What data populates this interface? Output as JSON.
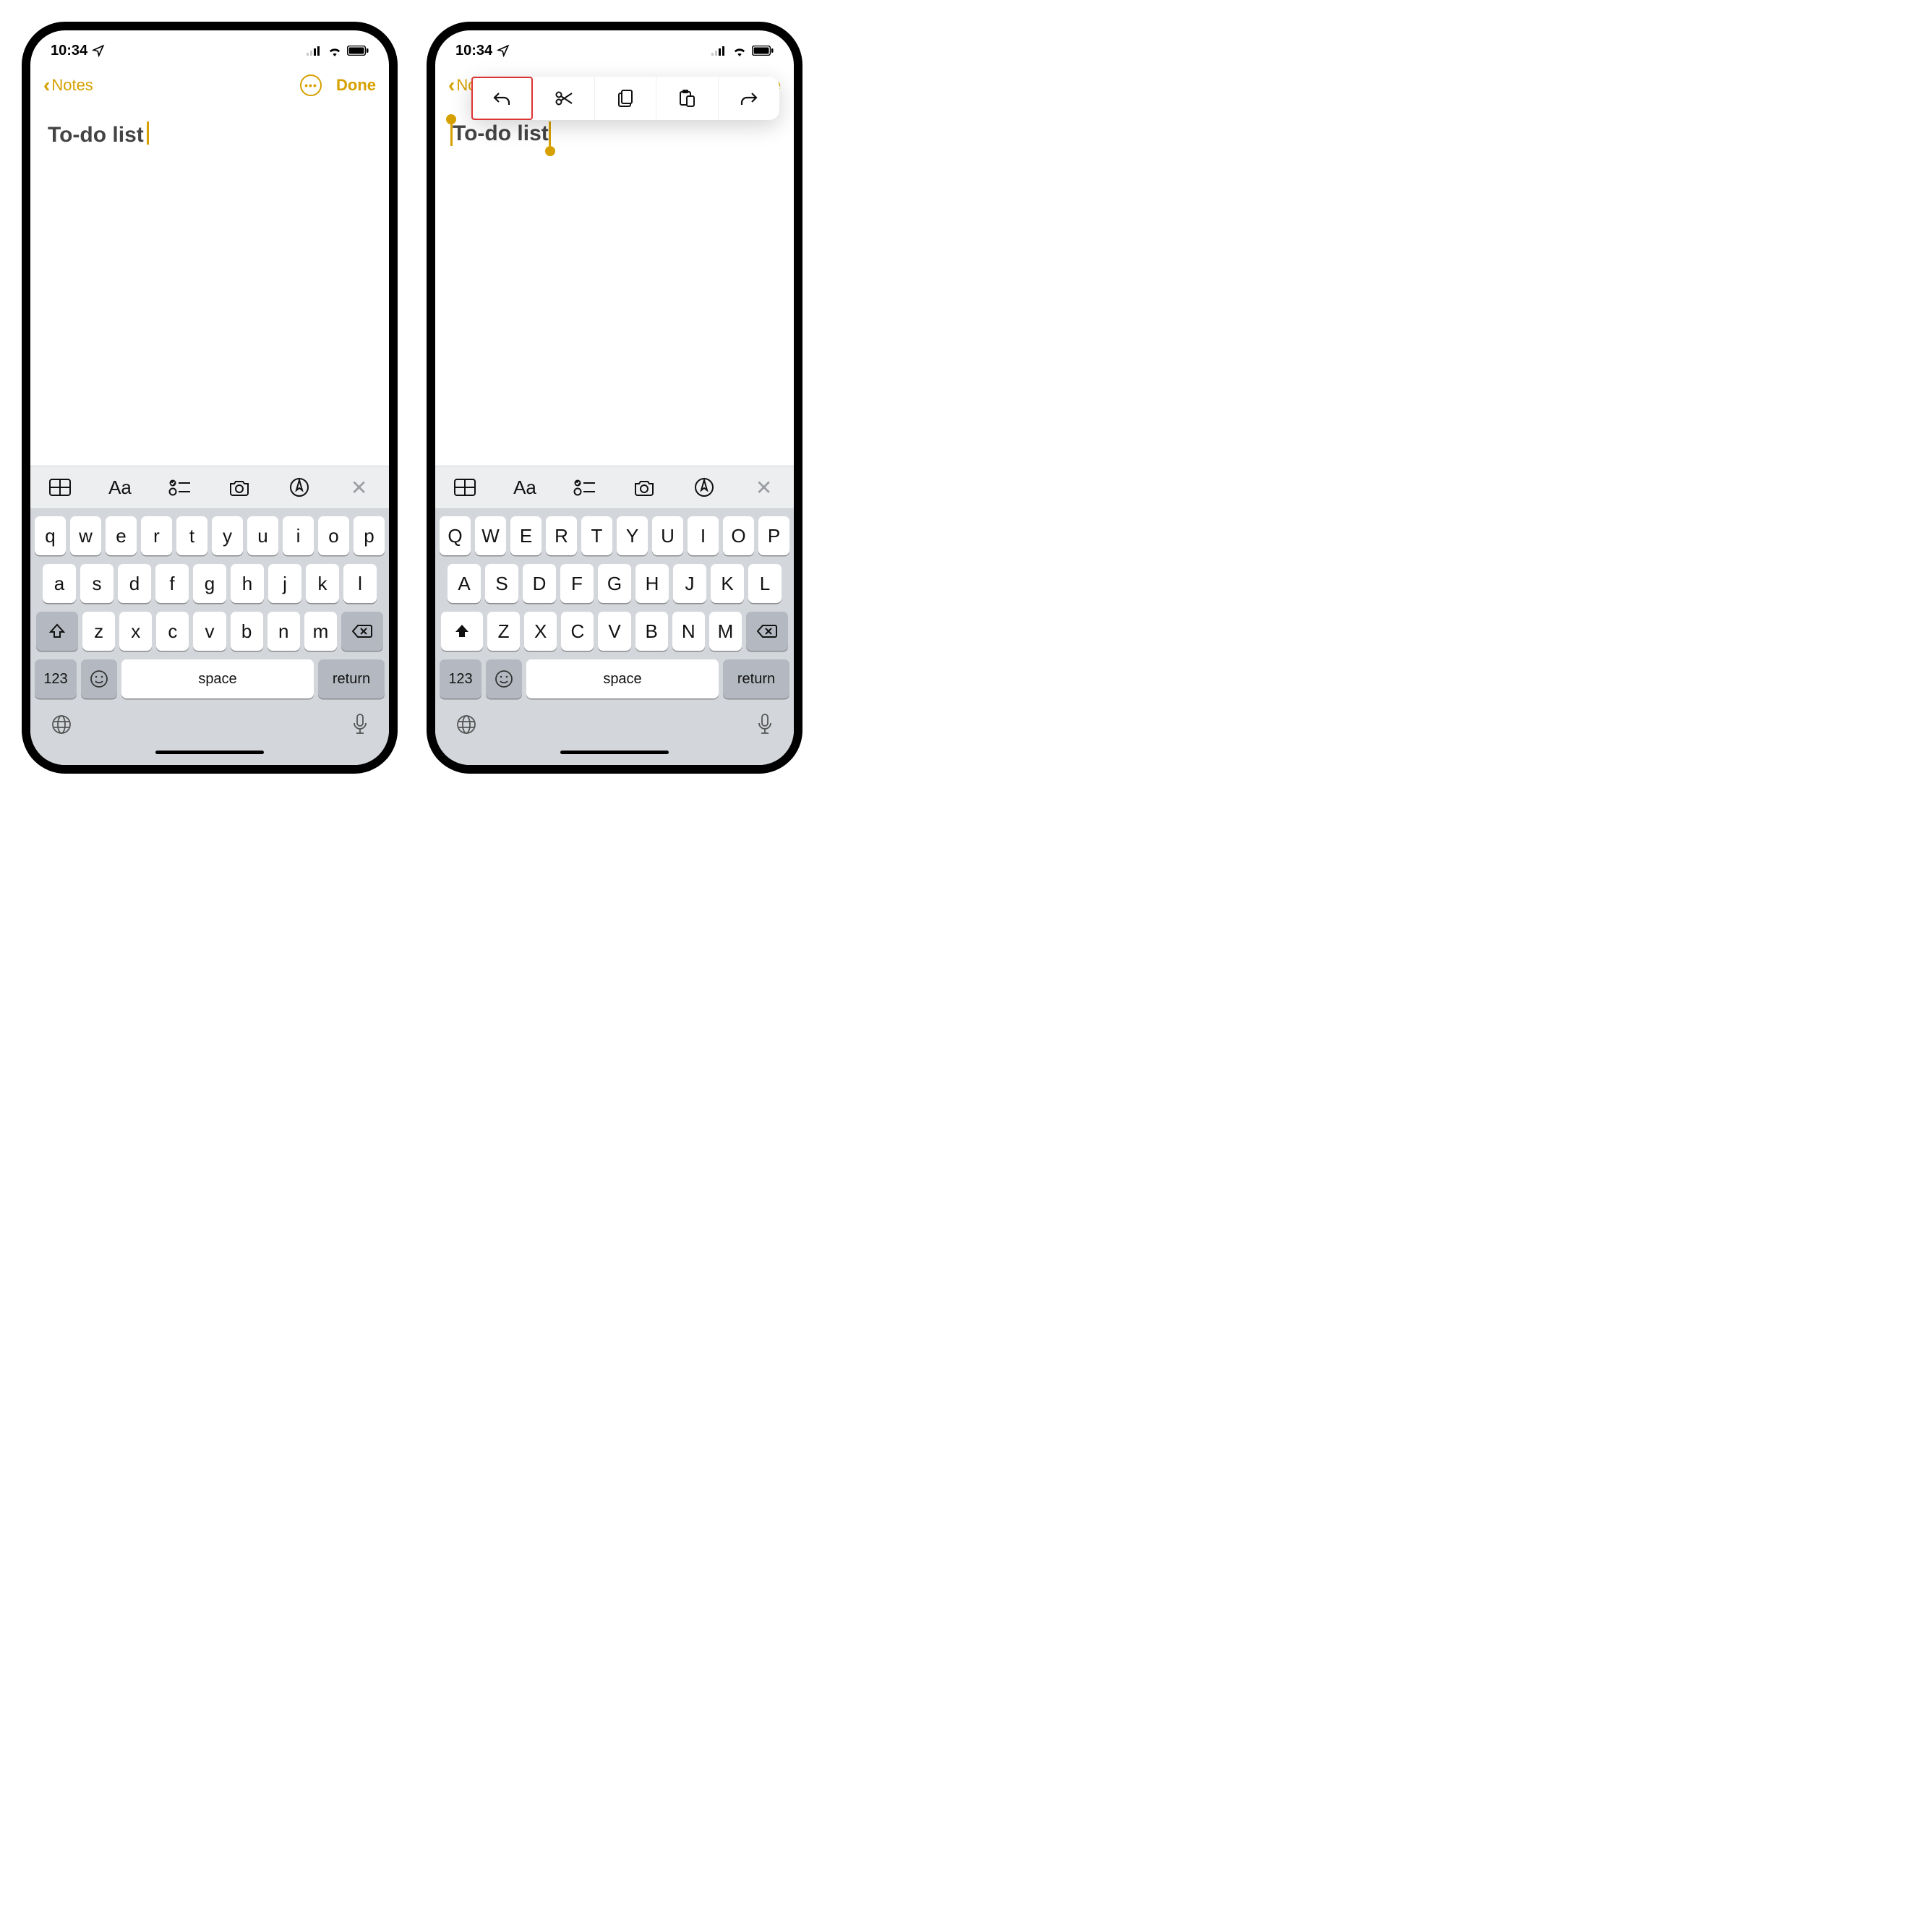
{
  "status": {
    "time": "10:34"
  },
  "nav": {
    "back_label": "Notes",
    "done_label": "Done",
    "done_label_partial": "one"
  },
  "note": {
    "title": "To-do list"
  },
  "keyboard": {
    "rows_lower": [
      [
        "q",
        "w",
        "e",
        "r",
        "t",
        "y",
        "u",
        "i",
        "o",
        "p"
      ],
      [
        "a",
        "s",
        "d",
        "f",
        "g",
        "h",
        "j",
        "k",
        "l"
      ],
      [
        "z",
        "x",
        "c",
        "v",
        "b",
        "n",
        "m"
      ]
    ],
    "rows_upper": [
      [
        "Q",
        "W",
        "E",
        "R",
        "T",
        "Y",
        "U",
        "I",
        "O",
        "P"
      ],
      [
        "A",
        "S",
        "D",
        "F",
        "G",
        "H",
        "J",
        "K",
        "L"
      ],
      [
        "Z",
        "X",
        "C",
        "V",
        "B",
        "N",
        "M"
      ]
    ],
    "num_label": "123",
    "space_label": "space",
    "return_label": "return"
  },
  "format_bar": {
    "aa_label": "Aa"
  },
  "popover": {
    "items": [
      "undo",
      "cut",
      "copy",
      "paste",
      "redo"
    ]
  }
}
